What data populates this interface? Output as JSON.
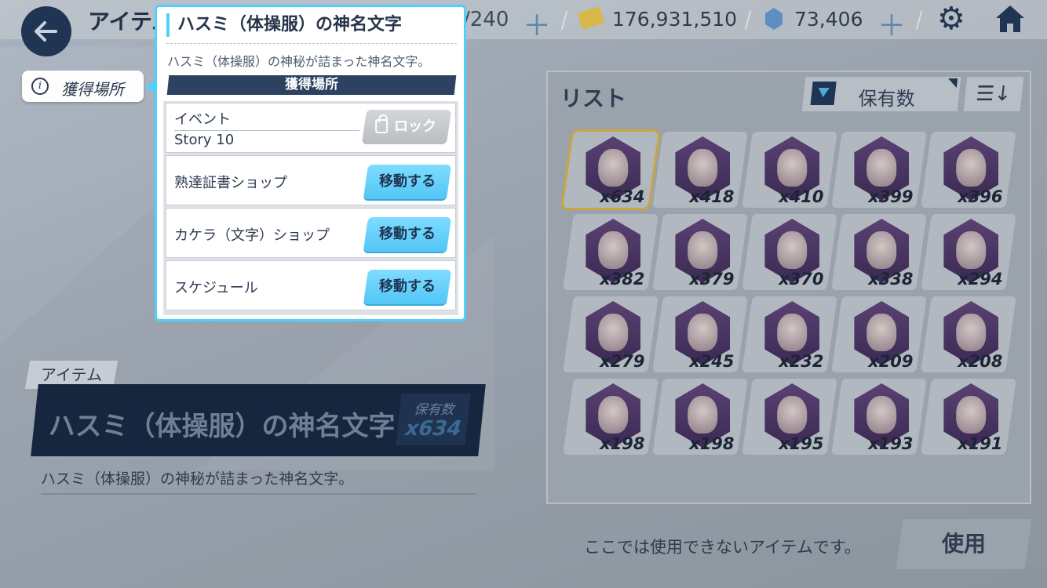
{
  "header": {
    "title": "アイテム",
    "capacity": "/240",
    "credits": "176,931,510",
    "gems": "73,406"
  },
  "acquisition_tag": {
    "label": "獲得場所"
  },
  "item": {
    "category": "アイテム",
    "name": "ハスミ（体操服）の神名文字",
    "owned_label": "保有数",
    "owned_value": "x634",
    "description": "ハスミ（体操服）の神秘が詰まった神名文字。"
  },
  "list": {
    "title": "リスト",
    "sort_label": "保有数",
    "counts": [
      "x634",
      "x418",
      "x410",
      "x399",
      "x396",
      "x382",
      "x379",
      "x370",
      "x338",
      "x294",
      "x279",
      "x245",
      "x232",
      "x209",
      "x208",
      "x198",
      "x198",
      "x195",
      "x193",
      "x191"
    ]
  },
  "footer": {
    "note": "ここでは使用できないアイテムです。",
    "use_label": "使用"
  },
  "popup": {
    "title": "ハスミ（体操服）の神名文字",
    "description": "ハスミ（体操服）の神秘が詰まった神名文字。",
    "section_header": "獲得場所",
    "sources": [
      {
        "category": "イベント",
        "name": "Story 10",
        "button": "ロック"
      },
      {
        "name": "熟達証書ショップ",
        "button": "移動する"
      },
      {
        "name": "カケラ（文字）ショップ",
        "button": "移動する"
      },
      {
        "name": "スケジュール",
        "button": "移動する"
      }
    ]
  },
  "colors": {
    "accent": "#4fd1ff",
    "navy": "#1f3553",
    "go_button": "#53c6f6"
  }
}
